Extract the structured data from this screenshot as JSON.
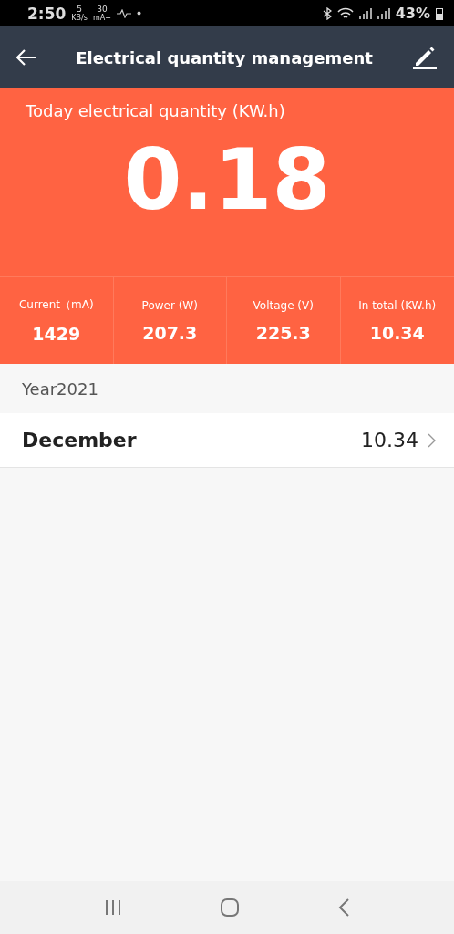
{
  "status_bar": {
    "time": "2:50",
    "net_speed": "5",
    "net_unit": "KB/s",
    "current": "30",
    "current_unit": "mA+",
    "battery": "43%"
  },
  "header": {
    "title": "Electrical quantity management"
  },
  "today": {
    "label": "Today electrical quantity (KW.h)",
    "value": "0.18"
  },
  "stats": [
    {
      "label": "Current（mA)",
      "value": "1429"
    },
    {
      "label": "Power (W)",
      "value": "207.3"
    },
    {
      "label": "Voltage (V)",
      "value": "225.3"
    },
    {
      "label": "In total (KW.h)",
      "value": "10.34"
    }
  ],
  "year": "Year2021",
  "months": [
    {
      "name": "December",
      "value": "10.34"
    }
  ]
}
